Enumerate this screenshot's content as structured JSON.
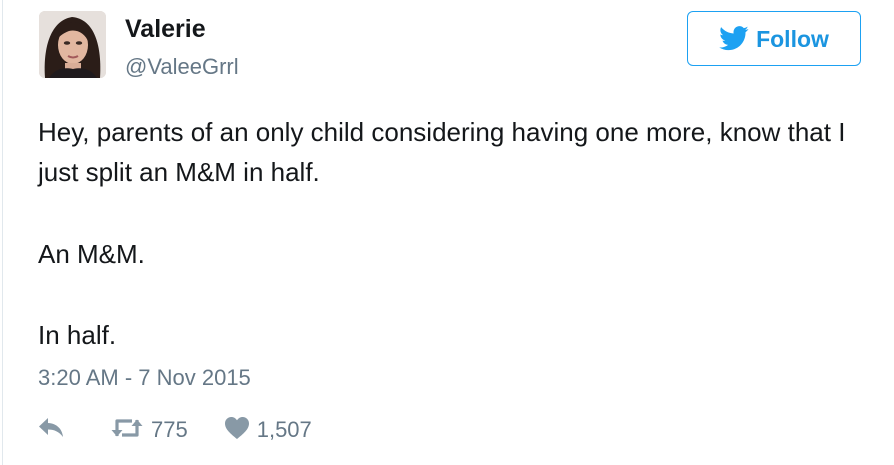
{
  "user": {
    "display_name": "Valerie",
    "handle": "@ValeeGrrl"
  },
  "follow_button": {
    "label": "Follow",
    "icon": "twitter-bird-icon"
  },
  "tweet": {
    "paragraphs": [
      "Hey, parents of an only child considering having one more, know that I just split an M&M in half.",
      "An M&M.",
      "In half."
    ],
    "timestamp": "3:20 AM - 7 Nov 2015"
  },
  "actions": {
    "reply": {
      "icon": "reply-icon"
    },
    "retweet": {
      "icon": "retweet-icon",
      "count": "775"
    },
    "like": {
      "icon": "heart-icon",
      "count": "1,507"
    }
  },
  "colors": {
    "accent": "#1da1f2",
    "text": "#14171a",
    "secondary": "#657786",
    "icon": "#8899a6"
  }
}
